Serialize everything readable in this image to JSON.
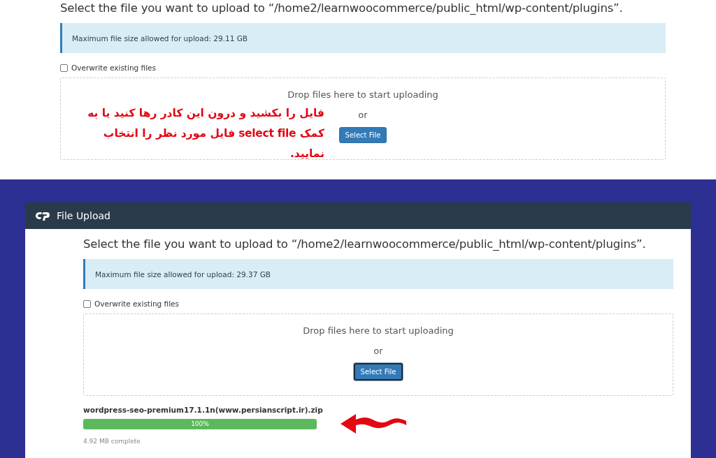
{
  "upper_screenshot": {
    "heading": "Select the file you want to upload to “/home2/learnwoocommerce/public_html/wp-content/plugins”.",
    "info": "Maximum file size allowed for upload: 29.11 GB",
    "overwrite": {
      "label": "Overwrite existing files",
      "checked": false
    },
    "dropzone": {
      "prompt": "Drop files here to start uploading",
      "or": "or",
      "button": {
        "label": "Select File",
        "focused": false
      }
    },
    "annotation": "فایل را بکشید و درون این کادر رها کنید یا به کمک select file فایل مورد نظر را انتخاب نمایید."
  },
  "upload_panel": {
    "title": "File Upload",
    "heading": "Select the file you want to upload to “/home2/learnwoocommerce/public_html/wp-content/plugins”.",
    "info": "Maximum file size allowed for upload: 29.37 GB",
    "overwrite": {
      "label": "Overwrite existing files",
      "checked": false
    },
    "dropzone": {
      "prompt": "Drop files here to start uploading",
      "or": "or",
      "button": {
        "label": "Select File",
        "focused": true
      }
    },
    "upload": {
      "file": "wordpress-seo-premium17.1.1n(www.persianscript.ir).zip",
      "level": 1,
      "percent": "100%",
      "status": "4.92 MB complete"
    }
  }
}
